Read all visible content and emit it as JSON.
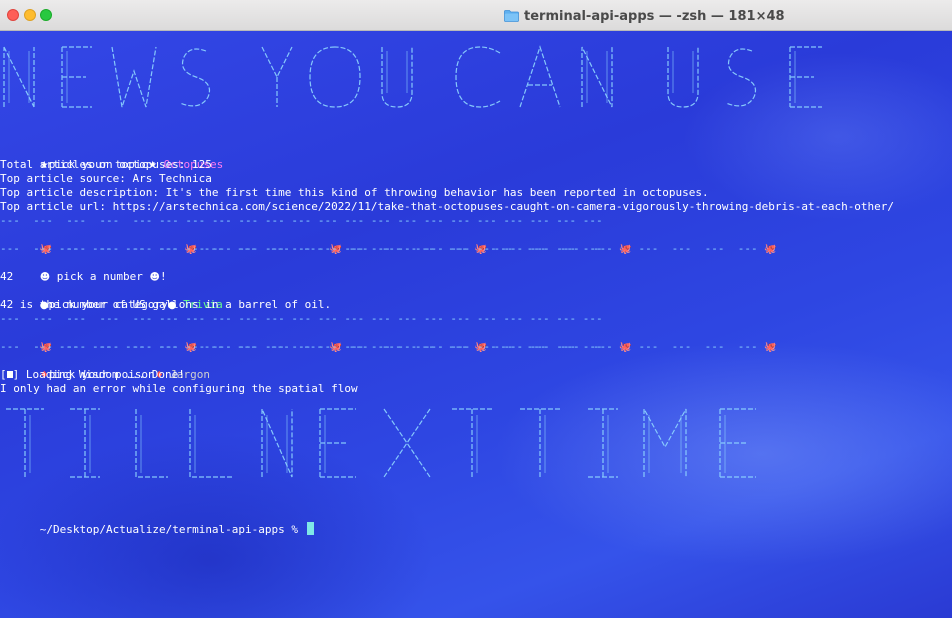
{
  "window": {
    "title": "terminal-api-apps — -zsh — 181×48",
    "colors": {
      "background": "#2436d6",
      "accent_cyan": "#8fd7ff",
      "magenta": "#ff7bf1",
      "green": "#69ff8c"
    }
  },
  "banners": {
    "top": "NEWS YOU CAN USE",
    "bottom": "TIL NEXT TIME"
  },
  "topic": {
    "prompt": "pick your topic",
    "prompt_icon": "glowing-star-icon",
    "answer": "Octopuses",
    "total": "Total articles on octopuses: 125",
    "source": "Top article source: Ars Technica",
    "description": "Top article description: It's the first time this kind of throwing behavior has been reported in octopuses.",
    "url": "Top article url: https://arstechnica.com/science/2022/11/take-that-octopuses-caught-on-camera-vigorously-throwing-debris-at-each-other/"
  },
  "separators": {
    "dash_line": "---  ---  ---  ---  --- --- --- --- --- --- --- --- --- --- --- --- --- --- --- --- --- ---",
    "octo_line": " ---  ---  ---  --- ",
    "octo_icon": "octopus-icon"
  },
  "number": {
    "prompt": " pick a number ",
    "prompt_icon": "disguised-face-icon",
    "suffix": "!",
    "answer": "42"
  },
  "category": {
    "prompt": "pick your category",
    "prompt_icon": "crystal-ball-icon",
    "answer": "Trivia",
    "result": "42 is the number of US gallons in a barrel of oil."
  },
  "poison": {
    "prompt": "pick your poison",
    "prompt_icon": "drop-of-blood-icon",
    "answer": "Jargon",
    "loading": "] Loading Wisdom ... Done!",
    "wisdom": "I only had an error while configuring the spatial flow"
  },
  "shell": {
    "prompt": "~/Desktop/Actualize/terminal-api-apps % "
  }
}
